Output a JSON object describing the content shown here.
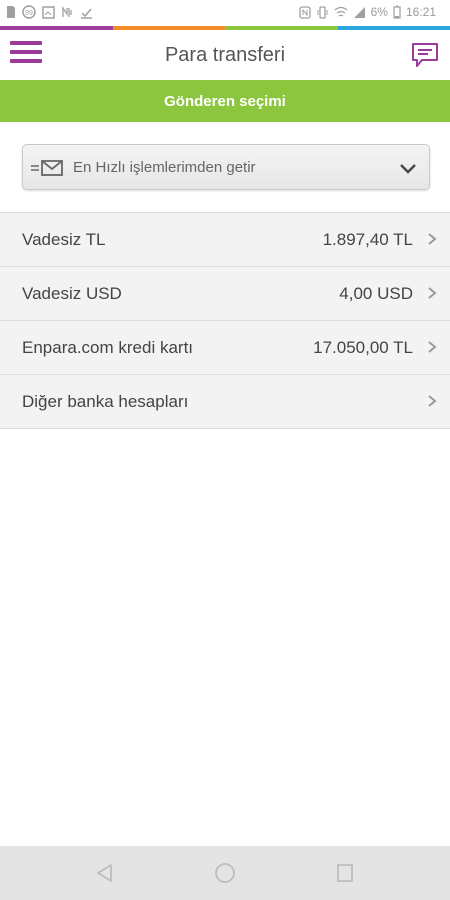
{
  "status_bar": {
    "battery_percent": "6%",
    "time": "16:21",
    "strip_colors": [
      "#9b3f9b",
      "#f28c28",
      "#8cc63f",
      "#29a8e0"
    ]
  },
  "app_bar": {
    "title": "Para transferi",
    "menu_icon": "hamburger-menu-icon",
    "chat_icon": "chat-bubble-icon"
  },
  "banner": {
    "label": "Gönderen seçimi"
  },
  "quick_select": {
    "label": "En Hızlı işlemlerimden getir",
    "icon": "envelope-transfer-icon"
  },
  "accounts": [
    {
      "name": "Vadesiz TL",
      "balance": "1.897,40 TL"
    },
    {
      "name": "Vadesiz USD",
      "balance": "4,00 USD"
    },
    {
      "name": "Enpara.com kredi kartı",
      "balance": "17.050,00 TL"
    },
    {
      "name": "Diğer banka hesapları",
      "balance": ""
    }
  ],
  "nav_bar": {
    "icons": [
      "back-icon",
      "home-icon",
      "recents-icon"
    ]
  },
  "colors": {
    "brand_purple": "#9a3a9a",
    "banner_green": "#8cc63f"
  }
}
